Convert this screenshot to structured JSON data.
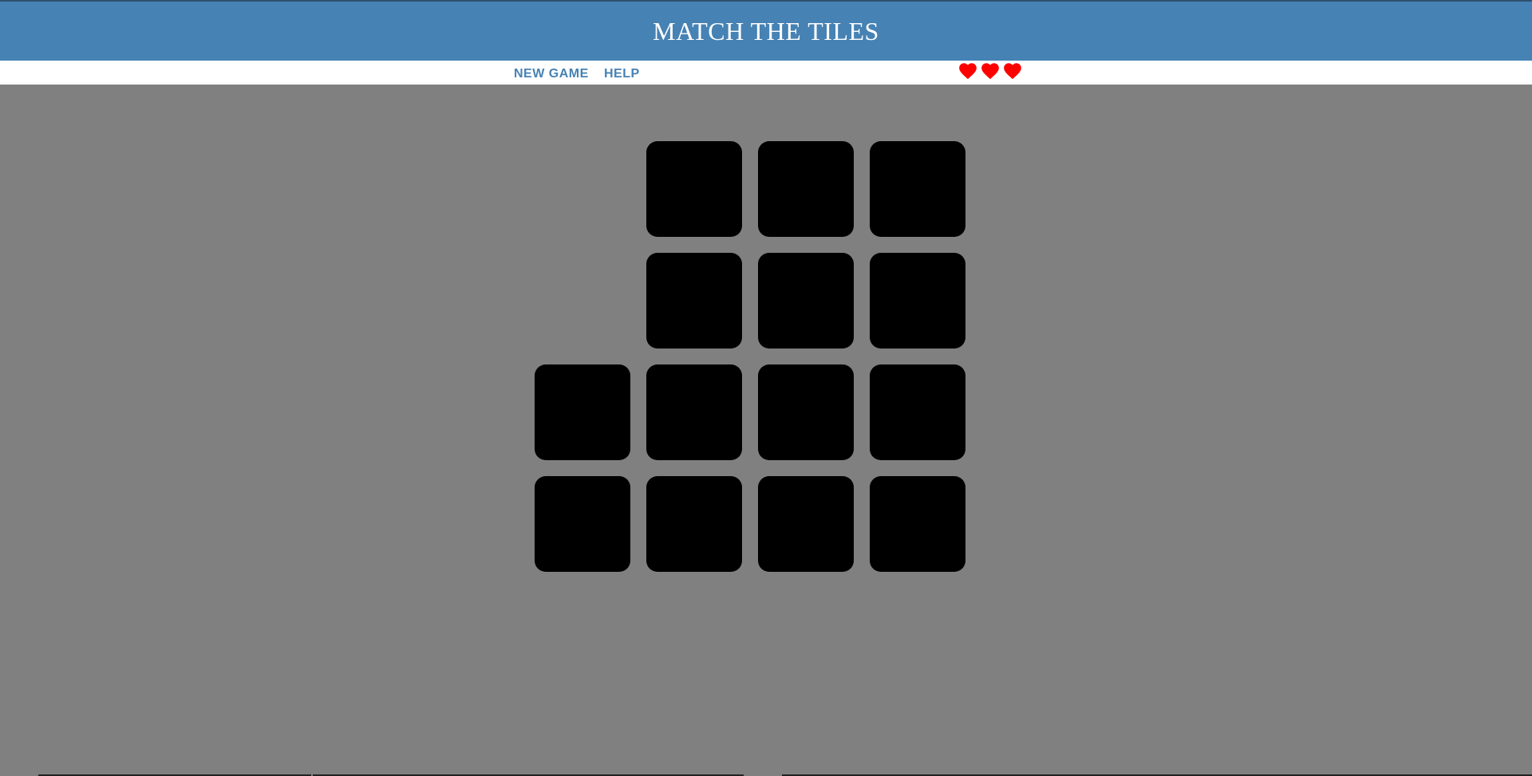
{
  "header": {
    "title": "MATCH THE TILES"
  },
  "menu": {
    "new_game_label": "NEW GAME",
    "help_label": "HELP"
  },
  "lives": {
    "count": 3,
    "icon": "heart-icon",
    "color": "#ff0000"
  },
  "colors": {
    "header_bg": "#4682b4",
    "menu_text": "#4682b4",
    "board_bg": "#808080",
    "tile_face_down": "#000000"
  },
  "board": {
    "rows": [
      [
        false,
        true,
        true,
        true
      ],
      [
        false,
        true,
        true,
        true
      ],
      [
        true,
        true,
        true,
        true
      ],
      [
        true,
        true,
        true,
        true
      ]
    ]
  }
}
